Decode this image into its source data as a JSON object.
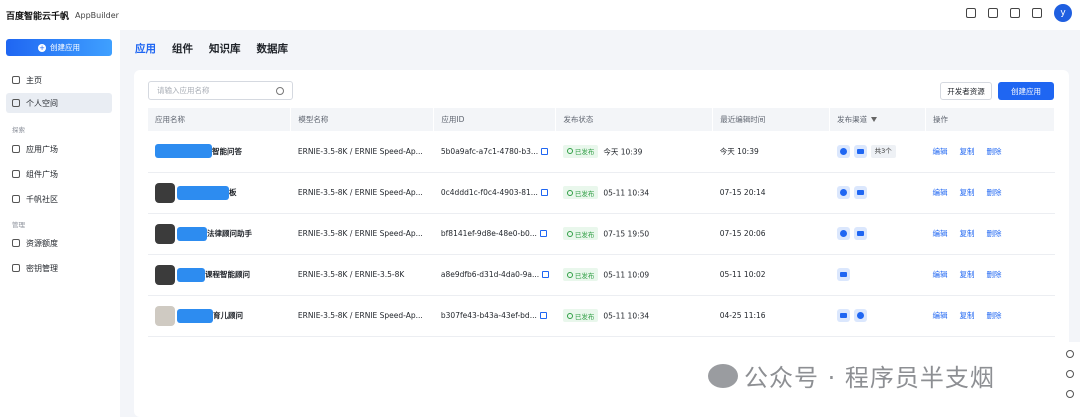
{
  "header": {
    "logo": "百度智能云千帆",
    "app_name": "AppBuilder",
    "avatar_letter": "y",
    "icons": [
      "folder-icon",
      "apps-grid-icon",
      "book-icon",
      "message-icon"
    ]
  },
  "sidebar": {
    "create_label": "创建应用",
    "items": [
      {
        "label": "主页",
        "icon": "home-icon"
      },
      {
        "label": "个人空间",
        "icon": "user-icon",
        "active": true
      }
    ],
    "group_explore": "探索",
    "explore_items": [
      {
        "label": "应用广场",
        "icon": "grid-icon"
      },
      {
        "label": "组件广场",
        "icon": "component-icon"
      },
      {
        "label": "千帆社区",
        "icon": "community-icon"
      }
    ],
    "group_manage": "管理",
    "manage_items": [
      {
        "label": "资源额度",
        "icon": "quota-icon"
      },
      {
        "label": "密钥管理",
        "icon": "key-icon"
      }
    ]
  },
  "tabs": [
    "应用",
    "组件",
    "知识库",
    "数据库"
  ],
  "toolbar": {
    "search_placeholder": "请输入应用名称",
    "dev_label": "开发者资源",
    "create_label": "创建应用"
  },
  "table": {
    "headers": [
      "应用名称",
      "模型名称",
      "应用ID",
      "发布状态",
      "最近编辑时间",
      "发布渠道",
      "操作"
    ],
    "rows": [
      {
        "name": "智能问答",
        "model": "ERNIE-3.5-8K / ERNIE Speed-Ap...",
        "id": "5b0a9afc-a7c1-4780-b3...",
        "status": "已发布",
        "pub_time": "今天 10:39",
        "edited": "今天 10:39",
        "more": "共3个"
      },
      {
        "name": "板",
        "model": "ERNIE-3.5-8K / ERNIE Speed-Ap...",
        "id": "0c4ddd1c-f0c4-4903-81...",
        "status": "已发布",
        "pub_time": "05-11 10:34",
        "edited": "07-15 20:14",
        "more": ""
      },
      {
        "name": "法律顾问助手",
        "model": "ERNIE-3.5-8K / ERNIE Speed-Ap...",
        "id": "bf8141ef-9d8e-48e0-b0...",
        "status": "已发布",
        "pub_time": "07-15 19:50",
        "edited": "07-15 20:06",
        "more": ""
      },
      {
        "name": "课程智能顾问",
        "model": "ERNIE-3.5-8K / ERNIE-3.5-8K",
        "id": "a8e9dfb6-d31d-4da0-9a...",
        "status": "已发布",
        "pub_time": "05-11 10:09",
        "edited": "05-11 10:02",
        "more": ""
      },
      {
        "name": "育儿顾问",
        "model": "ERNIE-3.5-8K / ERNIE Speed-Ap...",
        "id": "b307fe43-b43a-43ef-bd...",
        "status": "已发布",
        "pub_time": "05-11 10:34",
        "edited": "04-25 11:16",
        "more": ""
      }
    ],
    "ops": {
      "edit": "编辑",
      "copy": "复制",
      "delete": "删除"
    }
  },
  "watermark": "公众号 · 程序员半支烟",
  "colors": {
    "primary": "#1f66f2",
    "published": "#2f9e44"
  }
}
